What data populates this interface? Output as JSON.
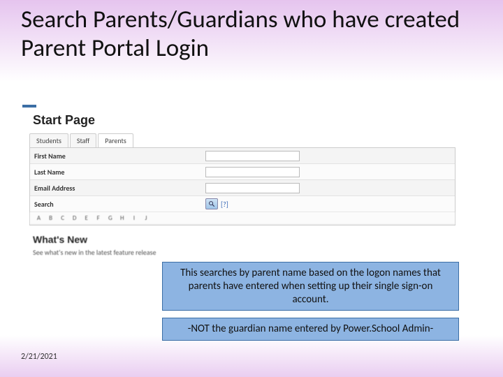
{
  "slide": {
    "title": "Search Parents/Guardians who have created Parent Portal Login",
    "footer_date": "2/21/2021"
  },
  "ps": {
    "start_page": "Start Page",
    "tabs": {
      "students": "Students",
      "staff": "Staff",
      "parents": "Parents"
    },
    "fields": {
      "first_name": "First Name",
      "last_name": "Last Name",
      "email": "Email Address",
      "search": "Search",
      "help": "[?]"
    },
    "alpha": [
      "A",
      "B",
      "C",
      "D",
      "E",
      "F",
      "G",
      "H",
      "I",
      "J"
    ],
    "whats_new": {
      "title": "What's New",
      "sub": "See what's new in the latest feature release"
    }
  },
  "callouts": {
    "c1": "This searches by parent name based on the logon names that parents have entered when setting up their single sign-on account.",
    "c2": "-NOT the guardian name entered by Power.School Admin-"
  }
}
